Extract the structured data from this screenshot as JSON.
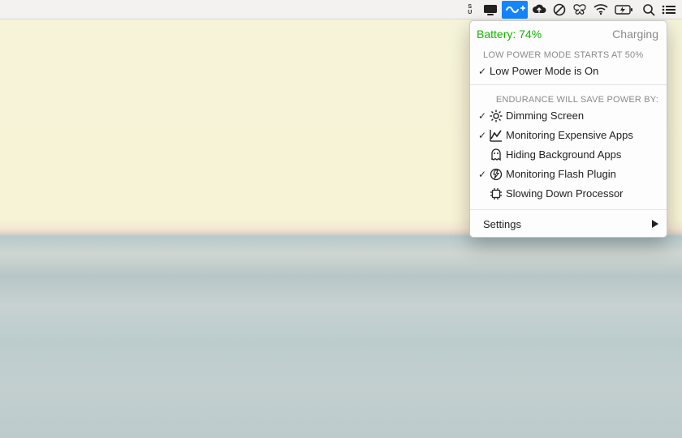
{
  "menubar": {
    "items": [
      {
        "name": "su-indicator",
        "kind": "text-stack",
        "lines": [
          "S",
          "U"
        ]
      },
      {
        "name": "display-icon"
      },
      {
        "name": "endurance-icon",
        "selected": true
      },
      {
        "name": "cloud-upload-icon"
      },
      {
        "name": "do-not-disturb-icon"
      },
      {
        "name": "butterfly-icon"
      },
      {
        "name": "wifi-icon"
      },
      {
        "name": "battery-status-icon"
      },
      {
        "name": "spotlight-search-icon"
      },
      {
        "name": "list-icon"
      }
    ]
  },
  "panel": {
    "battery_label": "Battery: 74%",
    "charging_label": "Charging",
    "low_power_caption": "LOW POWER MODE STARTS AT 50%",
    "low_power_state": "Low Power Mode is On",
    "save_caption": "ENDURANCE WILL SAVE POWER BY:",
    "options": [
      {
        "checked": true,
        "icon": "sun-icon",
        "label": "Dimming Screen"
      },
      {
        "checked": true,
        "icon": "chart-icon",
        "label": "Monitoring Expensive Apps"
      },
      {
        "checked": false,
        "icon": "ghost-icon",
        "label": "Hiding Background Apps"
      },
      {
        "checked": true,
        "icon": "flash-icon",
        "label": "Monitoring Flash Plugin"
      },
      {
        "checked": false,
        "icon": "chip-icon",
        "label": "Slowing Down Processor"
      }
    ],
    "settings_label": "Settings"
  }
}
